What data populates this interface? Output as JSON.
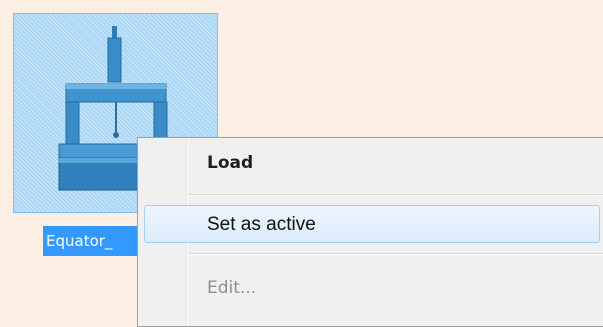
{
  "file": {
    "label": "Equator_",
    "icon": "gauge-machine-icon"
  },
  "context_menu": {
    "items": [
      {
        "label": "Load",
        "style": "bold"
      },
      {
        "label": "Set as active",
        "state": "highlighted"
      },
      {
        "label": "Edit...",
        "state": "disabled"
      }
    ]
  },
  "colors": {
    "background": "#fbeee3",
    "selection": "#3399ff",
    "tile": "#a9d6f5",
    "menu_background": "#f0f0f0",
    "highlight_border": "#a9cef4"
  }
}
